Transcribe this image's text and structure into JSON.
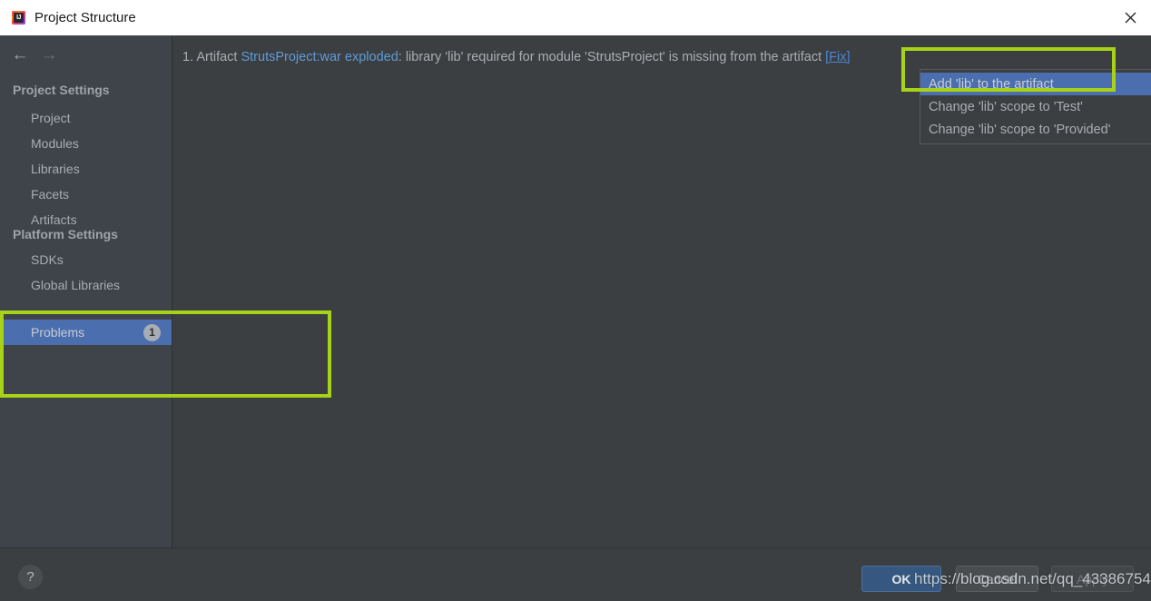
{
  "window": {
    "title": "Project Structure",
    "app_icon": "intellij-idea-icon",
    "icon_letters": "IJ",
    "close_icon": "close-icon"
  },
  "toolbar": {
    "back_icon": "arrow-left-icon",
    "back_glyph": "←",
    "forward_icon": "arrow-right-icon",
    "forward_glyph": "→"
  },
  "sidebar": {
    "sections": [
      {
        "label": "Project Settings"
      },
      {
        "label": "Platform Settings"
      }
    ],
    "project_settings_items": [
      {
        "label": "Project"
      },
      {
        "label": "Modules"
      },
      {
        "label": "Libraries"
      },
      {
        "label": "Facets"
      },
      {
        "label": "Artifacts"
      }
    ],
    "platform_settings_items": [
      {
        "label": "SDKs"
      },
      {
        "label": "Global Libraries"
      }
    ],
    "problems": {
      "label": "Problems",
      "count": "1",
      "selected": true
    }
  },
  "content": {
    "problem": {
      "index": "1.",
      "prefix": "Artifact",
      "artifact_link": "StrutsProject:war exploded",
      "message": ": library 'lib' required for module 'StrutsProject' is missing from the artifact",
      "fix_link": "[Fix]"
    }
  },
  "menu": {
    "items": [
      {
        "label": "Add 'lib' to the artifact",
        "active": true
      },
      {
        "label": "Change 'lib' scope to 'Test'",
        "active": false
      },
      {
        "label": "Change 'lib' scope to 'Provided'",
        "active": false
      }
    ]
  },
  "footer": {
    "help_label": "?",
    "ok_label": "OK",
    "cancel_label": "Cancel",
    "apply_label": "Apply"
  },
  "watermark": {
    "text": "https://blog.csdn.net/qq_43386754"
  },
  "colors": {
    "accent_blue": "#4b6eaf",
    "highlight_green": "#a8d217",
    "link_blue": "#5e9bd8",
    "ok_button": "#365880",
    "sidebar_bg": "#3f434a",
    "content_bg": "#3c3f41"
  }
}
